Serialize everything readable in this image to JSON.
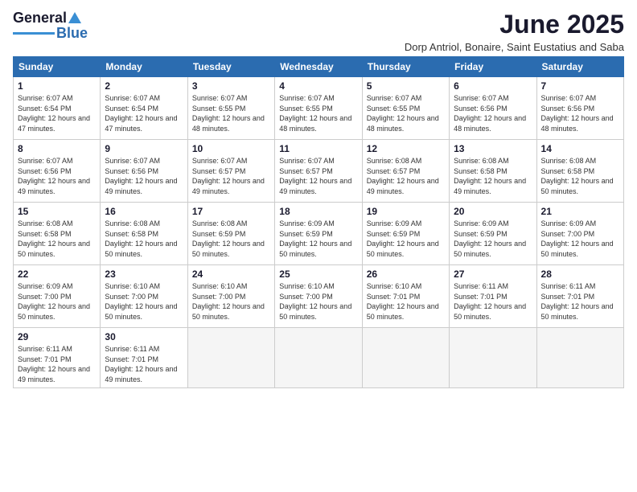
{
  "logo": {
    "line1": "General",
    "line2": "Blue"
  },
  "title": "June 2025",
  "subtitle": "Dorp Antriol, Bonaire, Saint Eustatius and Saba",
  "weekdays": [
    "Sunday",
    "Monday",
    "Tuesday",
    "Wednesday",
    "Thursday",
    "Friday",
    "Saturday"
  ],
  "weeks": [
    [
      {
        "day": "1",
        "rise": "6:07 AM",
        "set": "6:54 PM",
        "hours": "12 hours and 47 minutes."
      },
      {
        "day": "2",
        "rise": "6:07 AM",
        "set": "6:54 PM",
        "hours": "12 hours and 47 minutes."
      },
      {
        "day": "3",
        "rise": "6:07 AM",
        "set": "6:55 PM",
        "hours": "12 hours and 48 minutes."
      },
      {
        "day": "4",
        "rise": "6:07 AM",
        "set": "6:55 PM",
        "hours": "12 hours and 48 minutes."
      },
      {
        "day": "5",
        "rise": "6:07 AM",
        "set": "6:55 PM",
        "hours": "12 hours and 48 minutes."
      },
      {
        "day": "6",
        "rise": "6:07 AM",
        "set": "6:56 PM",
        "hours": "12 hours and 48 minutes."
      },
      {
        "day": "7",
        "rise": "6:07 AM",
        "set": "6:56 PM",
        "hours": "12 hours and 48 minutes."
      }
    ],
    [
      {
        "day": "8",
        "rise": "6:07 AM",
        "set": "6:56 PM",
        "hours": "12 hours and 49 minutes."
      },
      {
        "day": "9",
        "rise": "6:07 AM",
        "set": "6:56 PM",
        "hours": "12 hours and 49 minutes."
      },
      {
        "day": "10",
        "rise": "6:07 AM",
        "set": "6:57 PM",
        "hours": "12 hours and 49 minutes."
      },
      {
        "day": "11",
        "rise": "6:07 AM",
        "set": "6:57 PM",
        "hours": "12 hours and 49 minutes."
      },
      {
        "day": "12",
        "rise": "6:08 AM",
        "set": "6:57 PM",
        "hours": "12 hours and 49 minutes."
      },
      {
        "day": "13",
        "rise": "6:08 AM",
        "set": "6:58 PM",
        "hours": "12 hours and 49 minutes."
      },
      {
        "day": "14",
        "rise": "6:08 AM",
        "set": "6:58 PM",
        "hours": "12 hours and 50 minutes."
      }
    ],
    [
      {
        "day": "15",
        "rise": "6:08 AM",
        "set": "6:58 PM",
        "hours": "12 hours and 50 minutes."
      },
      {
        "day": "16",
        "rise": "6:08 AM",
        "set": "6:58 PM",
        "hours": "12 hours and 50 minutes."
      },
      {
        "day": "17",
        "rise": "6:08 AM",
        "set": "6:59 PM",
        "hours": "12 hours and 50 minutes."
      },
      {
        "day": "18",
        "rise": "6:09 AM",
        "set": "6:59 PM",
        "hours": "12 hours and 50 minutes."
      },
      {
        "day": "19",
        "rise": "6:09 AM",
        "set": "6:59 PM",
        "hours": "12 hours and 50 minutes."
      },
      {
        "day": "20",
        "rise": "6:09 AM",
        "set": "6:59 PM",
        "hours": "12 hours and 50 minutes."
      },
      {
        "day": "21",
        "rise": "6:09 AM",
        "set": "7:00 PM",
        "hours": "12 hours and 50 minutes."
      }
    ],
    [
      {
        "day": "22",
        "rise": "6:09 AM",
        "set": "7:00 PM",
        "hours": "12 hours and 50 minutes."
      },
      {
        "day": "23",
        "rise": "6:10 AM",
        "set": "7:00 PM",
        "hours": "12 hours and 50 minutes."
      },
      {
        "day": "24",
        "rise": "6:10 AM",
        "set": "7:00 PM",
        "hours": "12 hours and 50 minutes."
      },
      {
        "day": "25",
        "rise": "6:10 AM",
        "set": "7:00 PM",
        "hours": "12 hours and 50 minutes."
      },
      {
        "day": "26",
        "rise": "6:10 AM",
        "set": "7:01 PM",
        "hours": "12 hours and 50 minutes."
      },
      {
        "day": "27",
        "rise": "6:11 AM",
        "set": "7:01 PM",
        "hours": "12 hours and 50 minutes."
      },
      {
        "day": "28",
        "rise": "6:11 AM",
        "set": "7:01 PM",
        "hours": "12 hours and 50 minutes."
      }
    ],
    [
      {
        "day": "29",
        "rise": "6:11 AM",
        "set": "7:01 PM",
        "hours": "12 hours and 49 minutes."
      },
      {
        "day": "30",
        "rise": "6:11 AM",
        "set": "7:01 PM",
        "hours": "12 hours and 49 minutes."
      },
      null,
      null,
      null,
      null,
      null
    ]
  ],
  "labels": {
    "sunrise": "Sunrise:",
    "sunset": "Sunset:",
    "daylight": "Daylight:"
  }
}
